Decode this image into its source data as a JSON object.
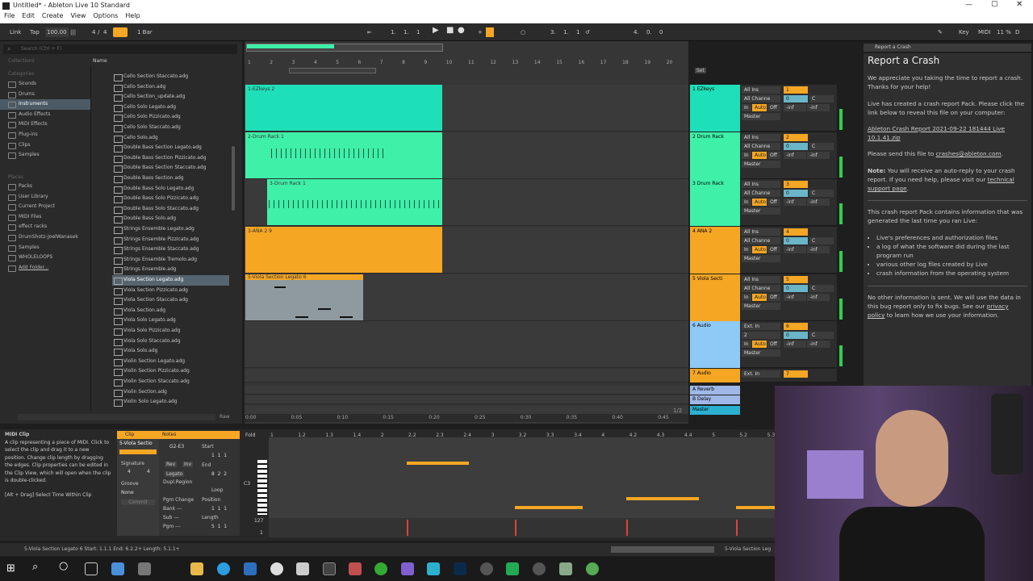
{
  "titlebar": {
    "title": "Untitled* - Ableton Live 10 Standard"
  },
  "menu": [
    "File",
    "Edit",
    "Create",
    "View",
    "Options",
    "Help"
  ],
  "control": {
    "link": "Link",
    "tap": "Tap",
    "tempo": "100.00",
    "sig_num": "4",
    "sig_den": "4",
    "quantize": "1 Bar",
    "pos_bars": "1.",
    "pos_beats": "1.",
    "pos_sixteenths": "1",
    "loop_start": "3.",
    "loop_start_b": "1.",
    "loop_start_s": "1",
    "loop_len": "4.",
    "loop_len_b": "0.",
    "loop_len_s": "0",
    "key": "Key",
    "midi": "MIDI",
    "cpu": "11 %",
    "disk": "D"
  },
  "browser": {
    "search_placeholder": "Search (Ctrl + F)",
    "collections_header": "Collections",
    "categories_header": "Categories",
    "categories": [
      "Sounds",
      "Drums",
      "Instruments",
      "Audio Effects",
      "MIDI Effects",
      "Plug-ins",
      "Clips",
      "Samples"
    ],
    "places_header": "Places",
    "places": [
      "Packs",
      "User Library",
      "Current Project",
      "MIDI Files",
      "effect racks",
      "DrumShotz-JoelWanasek",
      "Samples",
      "WHOLELOOPS",
      "Add Folder..."
    ],
    "name_header": "Name",
    "files": [
      "Cello Section Staccato.adg",
      "Cello Section.adg",
      "Cello Section_update.adg",
      "Cello Solo Legato.adg",
      "Cello Solo Pizzicato.adg",
      "Cello Solo Staccato.adg",
      "Cello Solo.adg",
      "Double Bass Section Legato.adg",
      "Double Bass Section Pizzicato.adg",
      "Double Bass Section Staccato.adg",
      "Double Bass Section.adg",
      "Double Bass Solo Legato.adg",
      "Double Bass Solo Pizzicato.adg",
      "Double Bass Solo Staccato.adg",
      "Double Bass Solo.adg",
      "Strings Ensemble Legato.adg",
      "Strings Ensemble Pizzicato.adg",
      "Strings Ensemble Staccato.adg",
      "Strings Ensemble Tremolo.adg",
      "Strings Ensemble.adg",
      "Viola Section Legato.adg",
      "Viola Section Pizzicato.adg",
      "Viola Section Staccato.adg",
      "Viola Section.adg",
      "Viola Solo Legato.adg",
      "Viola Solo Pizzicato.adg",
      "Viola Solo Staccato.adg",
      "Viola Solo.adg",
      "Violin Section Legato.adg",
      "Violin Section Pizzicato.adg",
      "Violin Section Staccato.adg",
      "Violin Section.adg",
      "Violin Solo Legato.adg"
    ],
    "raw": "Raw"
  },
  "ruler": [
    "1",
    "2",
    "3",
    "4",
    "5",
    "6",
    "7",
    "8",
    "9",
    "10",
    "11",
    "12",
    "13",
    "14",
    "15",
    "16",
    "17",
    "18",
    "19",
    "20"
  ],
  "time_ruler": [
    "0:00",
    "0:05",
    "0:10",
    "0:15",
    "0:20",
    "0:25",
    "0:30",
    "0:35",
    "0:40",
    "0:45"
  ],
  "set_label": "Set",
  "page": "1/2",
  "tracks": [
    {
      "num": "1",
      "name": "1 EZkeys",
      "clip": "1-EZkeys 2",
      "color": "#1ee0b8",
      "input": "All Ins",
      "channel": "All Channe",
      "vol": "0",
      "pan": "C",
      "send": "-inf"
    },
    {
      "num": "2",
      "name": "2 Drum Rack",
      "clip": "2-Drum Rack 1",
      "color": "#3ef0a8",
      "input": "All Ins",
      "channel": "All Channe",
      "vol": "0",
      "pan": "C",
      "send": "-inf"
    },
    {
      "num": "3",
      "name": "3 Drum Rack",
      "clip": "3-Drum Rack 1",
      "color": "#3ef0a8",
      "input": "All Ins",
      "channel": "All Channe",
      "vol": "0",
      "pan": "C",
      "send": "-inf"
    },
    {
      "num": "4",
      "name": "4 ANA 2",
      "clip": "3-ANA 2 9",
      "color": "#f5a623",
      "input": "All Ins",
      "channel": "All Channe",
      "vol": "0",
      "pan": "C",
      "send": "-inf"
    },
    {
      "num": "5",
      "name": "5 Viola Secti",
      "clip": "5-Viola Section Legato 6",
      "color": "#f5a623",
      "input": "All Ins",
      "channel": "All Channe",
      "vol": "0",
      "pan": "C",
      "send": "-inf"
    },
    {
      "num": "6",
      "name": "6 Audio",
      "clip": "",
      "color": "#8fc9f5",
      "input": "Ext. In",
      "channel": "2",
      "vol": "0",
      "pan": "C",
      "send": "-inf"
    },
    {
      "num": "7",
      "name": "7 Audio",
      "clip": "",
      "color": "#f5a623",
      "input": "Ext. In",
      "channel": "2",
      "vol": "",
      "pan": "",
      "send": ""
    }
  ],
  "returns": [
    "A Reverb",
    "B Delay",
    "Master"
  ],
  "master_out": "Master",
  "monitor": {
    "in": "In",
    "auto": "Auto",
    "off": "Off"
  },
  "crash": {
    "header": "Report a Crash",
    "title": "Report a Crash",
    "p1": "We appreciate you taking the time to report a crash. Thanks for your help!",
    "p2": "Live has created a crash report Pack. Please click the link below to reveal this file on your computer:",
    "link": "Ableton Crash Report 2021-09-22 181444 Live 10.1.41.zip",
    "p3a": "Please send this file to ",
    "email": "crashes@ableton.com",
    "p3b": ".",
    "note_b": "Note:",
    "note": " You will receive an auto-reply to your crash report. If you need help, please visit our ",
    "support": "technical support page",
    "p4": "This crash report Pack contains information that was generated the last time you ran Live:",
    "bullets": [
      "Live's preferences and authorization files",
      "a log of what the software did during the last program run",
      "various other log files created by Live",
      "crash information from the operating system"
    ],
    "p5a": "No other information is sent. We will use the data in this bug report only to fix bugs. See our ",
    "privacy": "privacy policy",
    "p5b": " to learn how we use your information."
  },
  "info": {
    "title": "MIDI Clip",
    "body": "A clip representing a piece of MIDI. Click to select the clip and drag it to a new position. Change clip length by dragging the edges. Clip properties can be edited in the Clip View, which will open when the clip is double-clicked.",
    "hint": "[Alt + Drag] Select Time Within Clip"
  },
  "clipview": {
    "clip_tab": "Clip",
    "notes_tab": "Notes",
    "clip_name": "5-Viola Sectio",
    "signature": "Signature",
    "sig": "4",
    "sig2": "4",
    "groove": "Groove",
    "groove_val": "None",
    "commit": "Commit",
    "range": "G2-E3",
    "start": "Start",
    "end": "End",
    "loop": "Loop",
    "position": "Position",
    "length": "Length",
    "rev": "Rev",
    "inv": "Inv",
    "legato": "Legato",
    "dupl": "Dupl.Region",
    "pgm": "Pgm Change",
    "bank": "Bank ---",
    "sub": "Sub ---",
    "pgm2": "Pgm ---",
    "fold": "Fold",
    "c3": "C3",
    "v127": "127",
    "v1": "1",
    "start_v": "1  1  1",
    "end_v": "8  2  2",
    "pos_v": "1  1  1",
    "len_v": "5  1  1"
  },
  "editor_ruler": [
    "1",
    "1.2",
    "1.3",
    "1.4",
    "2",
    "2.2",
    "2.3",
    "2.4",
    "3",
    "3.2",
    "3.3",
    "3.4",
    "4",
    "4.2",
    "4.3",
    "4.4",
    "5",
    "5.2",
    "5.3"
  ],
  "status": {
    "text": "5-Viola Section Legato 6  Start: 1.1.1  End: 6.2.2+  Length: 5.1.1+",
    "track": "5-Viola Section Leg"
  }
}
